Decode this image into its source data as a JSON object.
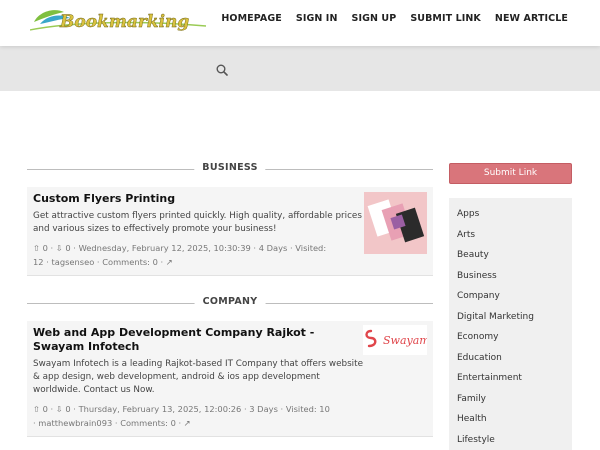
{
  "header": {
    "logo_text": "Bookmarking",
    "nav": [
      "HOMEPAGE",
      "SIGN IN",
      "SIGN UP",
      "SUBMIT LINK",
      "NEW ARTICLE"
    ]
  },
  "search": {
    "icon": "search-icon"
  },
  "sections": [
    {
      "label": "BUSINESS",
      "title": "Custom Flyers Printing",
      "desc": "Get attractive custom flyers printed quickly. High quality, affordable prices and various sizes to effectively promote your business!",
      "up": "0",
      "down": "0",
      "date": "Wednesday, February 12, 2025, 10:30:39",
      "age": "4 Days",
      "visited": "Visited: 12",
      "user": "tagsenseo",
      "comments": "Comments: 0"
    },
    {
      "label": "COMPANY",
      "title": "Web and App Development Company Rajkot - Swayam Infotech",
      "desc": "Swayam Infotech is a leading Rajkot-based IT Company that offers website & app design, web development, android & ios app development worldwide. Contact us Now.",
      "up": "0",
      "down": "0",
      "date": "Thursday, February 13, 2025, 12:00:26",
      "age": "3 Days",
      "visited": "Visited: 10",
      "user": "matthewbrain093",
      "comments": "Comments: 0",
      "thumb_logo_text": "Swayam"
    }
  ],
  "sidebar": {
    "submit_label": "Submit Link",
    "categories": [
      "Apps",
      "Arts",
      "Beauty",
      "Business",
      "Company",
      "Digital Marketing",
      "Economy",
      "Education",
      "Entertainment",
      "Family",
      "Health",
      "Lifestyle"
    ]
  },
  "colors": {
    "accent": "#d9757b",
    "band": "#e6e6e6",
    "card": "#f5f5f5"
  }
}
